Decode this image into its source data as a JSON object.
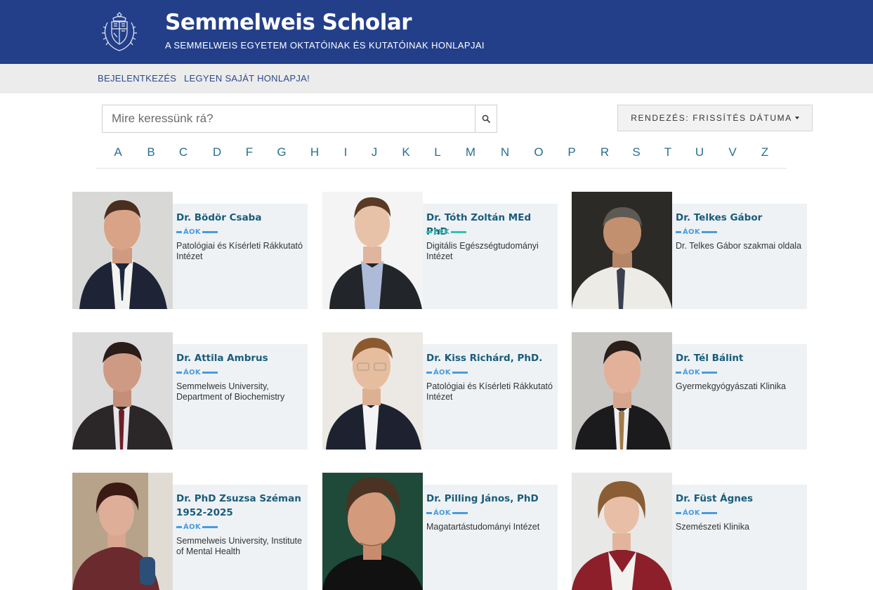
{
  "header": {
    "title": "Semmelweis Scholar",
    "subtitle": "A SEMMELWEIS EGYETEM OKTATÓINAK ÉS KUTATÓINAK HONLAPJAI"
  },
  "nav": {
    "login": "BEJELENTKEZÉS",
    "own_page": "LEGYEN SAJÁT HONLAPJA!"
  },
  "search": {
    "placeholder": "Mire keressünk rá?",
    "sort_label": "RENDEZÉS: FRISSÍTÉS DÁTUMA"
  },
  "alphabet": [
    "A",
    "B",
    "C",
    "D",
    "F",
    "G",
    "H",
    "I",
    "J",
    "K",
    "L",
    "M",
    "N",
    "O",
    "P",
    "R",
    "S",
    "T",
    "U",
    "V",
    "Z"
  ],
  "colors": {
    "header_bg": "#233f8a",
    "nav_bg": "#ececec",
    "name_text": "#1a5c7a",
    "aok_accent": "#4a9be0",
    "ekk_accent": "#2fc4b2",
    "card_bg": "#eef2f5"
  },
  "profiles": [
    {
      "name": "Dr. Bödör Csaba",
      "faculty": "ÁOK",
      "description": "Patológiai és Kísérleti Rákkutató Intézet"
    },
    {
      "name": "Dr. Tóth Zoltán MEd PhD",
      "faculty": "EKK",
      "description": "Digitális Egészségtudományi Intézet"
    },
    {
      "name": "Dr. Telkes Gábor",
      "faculty": "ÁOK",
      "description": "Dr. Telkes Gábor szakmai oldala"
    },
    {
      "name": "Dr. Attila Ambrus",
      "faculty": "ÁOK",
      "description": "Semmelweis University, Department of Biochemistry"
    },
    {
      "name": "Dr. Kiss Richárd, PhD.",
      "faculty": "ÁOK",
      "description": "Patológiai és Kísérleti Rákkutató Intézet"
    },
    {
      "name": "Dr. Tél Bálint",
      "faculty": "ÁOK",
      "description": "Gyermekgyógyászati Klinika"
    },
    {
      "name": "Dr. PhD Zsuzsa Széman 1952-2025",
      "faculty": "ÁOK",
      "description": "Semmelweis University, Institute of Mental Health"
    },
    {
      "name": "Dr. Pilling János, PhD",
      "faculty": "ÁOK",
      "description": "Magatartástudományi Intézet"
    },
    {
      "name": "Dr. Füst Ágnes",
      "faculty": "ÁOK",
      "description": "Szemészeti Klinika"
    }
  ]
}
